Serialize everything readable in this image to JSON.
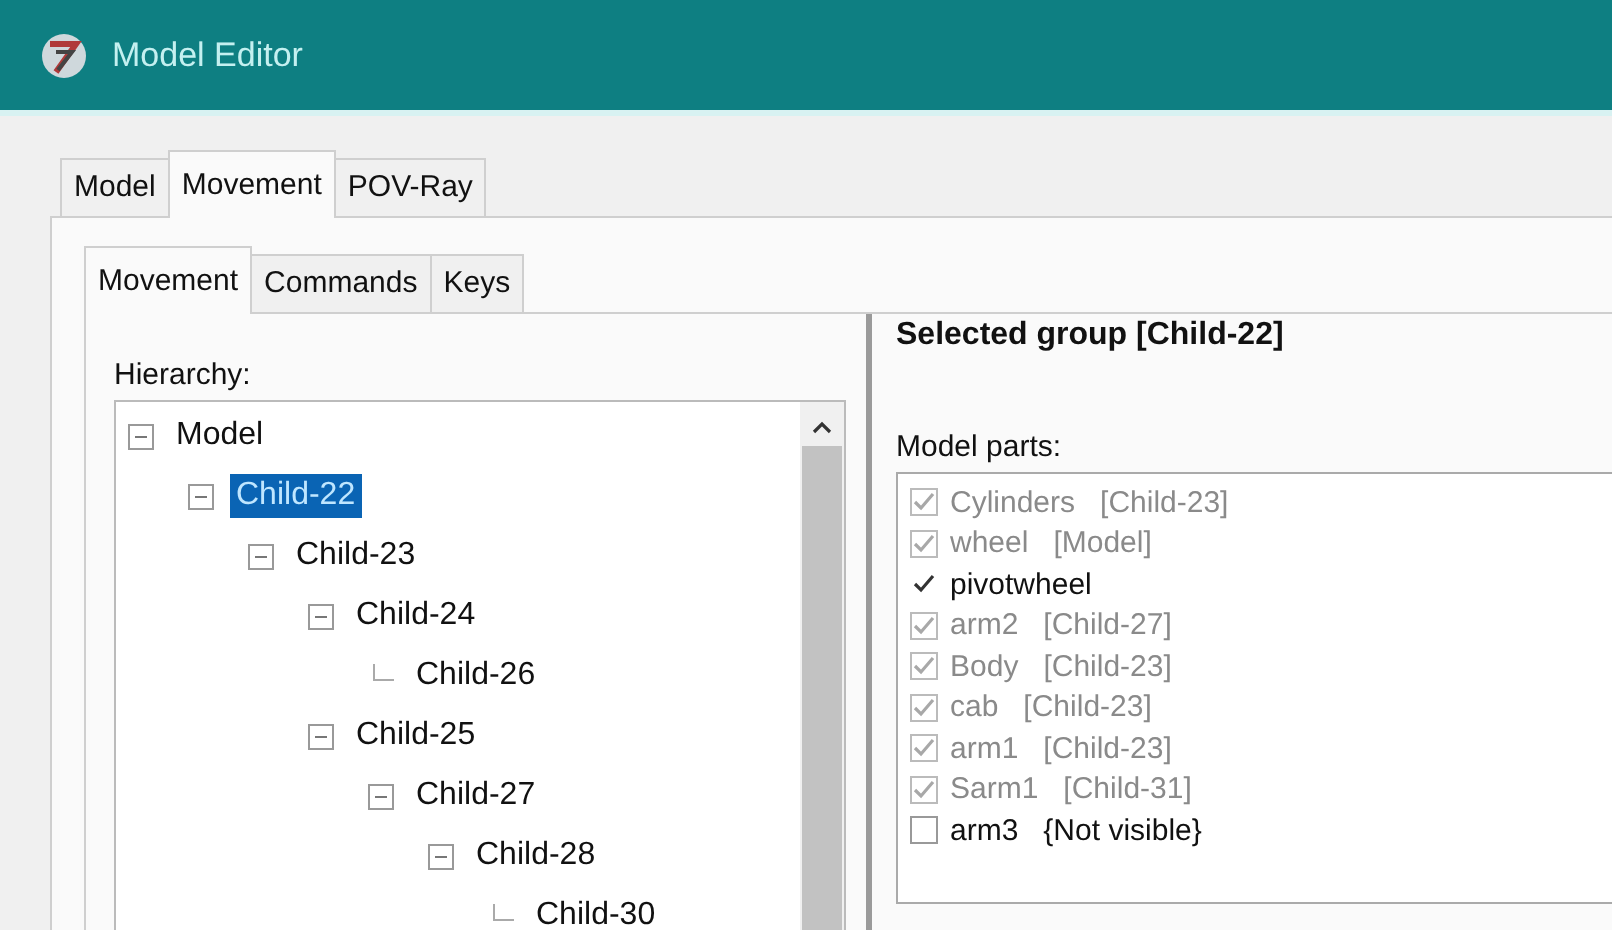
{
  "window": {
    "title": "Model Editor"
  },
  "tabs": [
    {
      "label": "Model",
      "selected": false
    },
    {
      "label": "Movement",
      "selected": true
    },
    {
      "label": "POV-Ray",
      "selected": false
    }
  ],
  "subtabs": [
    {
      "label": "Movement",
      "selected": true
    },
    {
      "label": "Commands",
      "selected": false
    },
    {
      "label": "Keys",
      "selected": false
    }
  ],
  "hierarchy": {
    "label": "Hierarchy:",
    "tree": [
      {
        "label": "Model",
        "expanded": true,
        "selected": false,
        "children": [
          {
            "label": "Child-22",
            "expanded": true,
            "selected": true,
            "children": [
              {
                "label": "Child-23",
                "expanded": true,
                "selected": false,
                "children": [
                  {
                    "label": "Child-24",
                    "expanded": true,
                    "selected": false,
                    "children": [
                      {
                        "label": "Child-26",
                        "selected": false
                      }
                    ]
                  },
                  {
                    "label": "Child-25",
                    "expanded": true,
                    "selected": false,
                    "children": [
                      {
                        "label": "Child-27",
                        "expanded": true,
                        "selected": false,
                        "children": [
                          {
                            "label": "Child-28",
                            "expanded": true,
                            "selected": false,
                            "children": [
                              {
                                "label": "Child-30",
                                "selected": false
                              }
                            ]
                          }
                        ]
                      }
                    ]
                  }
                ]
              }
            ]
          }
        ]
      }
    ]
  },
  "group": {
    "title": "Selected group [Child-22]",
    "parts_label": "Model parts:",
    "parts": [
      {
        "label": "Cylinders   [Child-23]",
        "checked": true,
        "disabled": true
      },
      {
        "label": "wheel   [Model]",
        "checked": true,
        "disabled": true
      },
      {
        "label": "pivotwheel",
        "checked": true,
        "disabled": false
      },
      {
        "label": "arm2   [Child-27]",
        "checked": true,
        "disabled": true
      },
      {
        "label": "Body   [Child-23]",
        "checked": true,
        "disabled": true
      },
      {
        "label": "cab   [Child-23]",
        "checked": true,
        "disabled": true
      },
      {
        "label": "arm1   [Child-23]",
        "checked": true,
        "disabled": true
      },
      {
        "label": "Sarm1   [Child-31]",
        "checked": true,
        "disabled": true
      },
      {
        "label": "arm3   {Not visible}",
        "checked": false,
        "disabled": false
      }
    ]
  }
}
